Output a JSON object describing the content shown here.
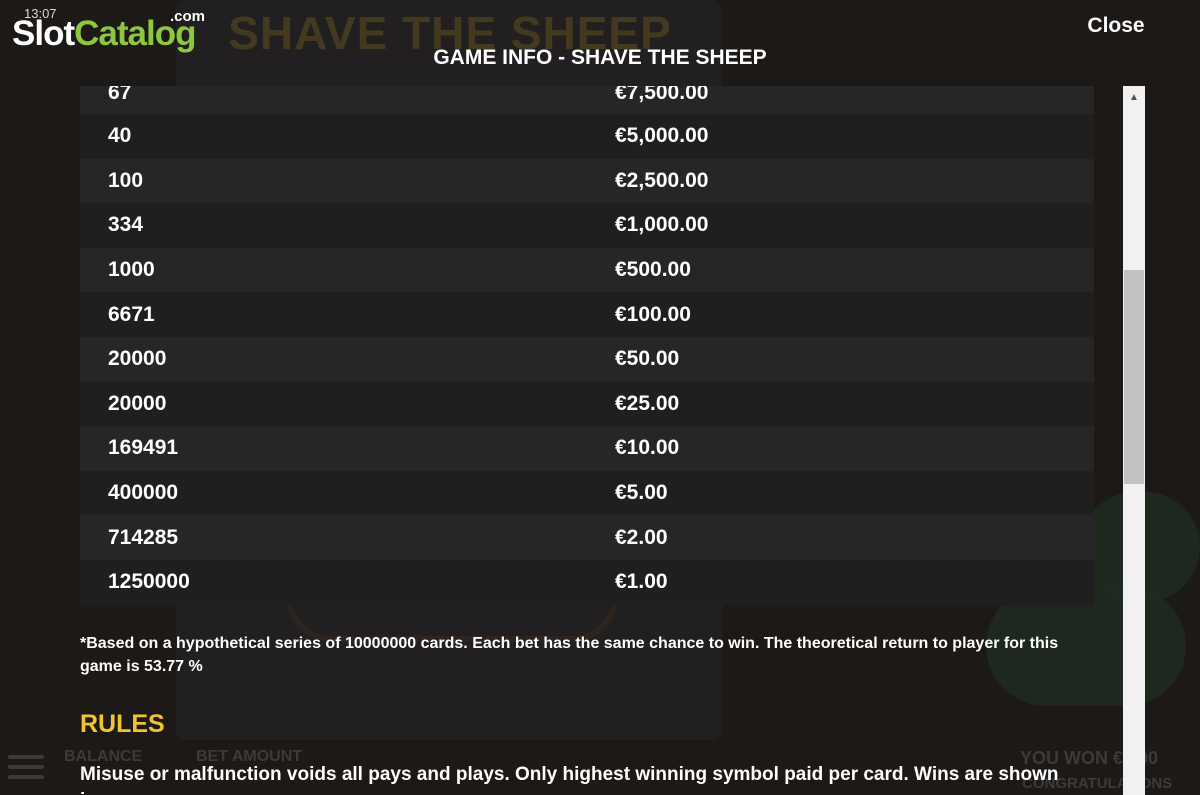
{
  "status": {
    "time": "13:07"
  },
  "logo": {
    "part1": "Slot",
    "part2": "Catalog",
    "suffix": ".com"
  },
  "header": {
    "close_label": "Close",
    "title": "GAME INFO - SHAVE THE SHEEP"
  },
  "pay_table": {
    "rows": [
      {
        "count": "67",
        "prize": "€7,500.00"
      },
      {
        "count": "40",
        "prize": "€5,000.00"
      },
      {
        "count": "100",
        "prize": "€2,500.00"
      },
      {
        "count": "334",
        "prize": "€1,000.00"
      },
      {
        "count": "1000",
        "prize": "€500.00"
      },
      {
        "count": "6671",
        "prize": "€100.00"
      },
      {
        "count": "20000",
        "prize": "€50.00"
      },
      {
        "count": "20000",
        "prize": "€25.00"
      },
      {
        "count": "169491",
        "prize": "€10.00"
      },
      {
        "count": "400000",
        "prize": "€5.00"
      },
      {
        "count": "714285",
        "prize": "€2.00"
      },
      {
        "count": "1250000",
        "prize": "€1.00"
      }
    ]
  },
  "note": "*Based on a hypothetical series of 10000000 cards. Each bet has the same chance to win. The theoretical return to player for this game is 53.77 %",
  "rules": {
    "heading": "RULES",
    "text": "Misuse or malfunction voids all pays and plays. Only highest winning symbol paid per card. Wins are shown in"
  },
  "background": {
    "game_title": "SHAVE THE SHEEP",
    "balance_label": "BALANCE",
    "bet_label": "BET AMOUNT",
    "won_label": "YOU WON €0.00",
    "congrats": "CONGRATULATIONS"
  },
  "colors": {
    "accent_rules": "#f2c230",
    "logo_green": "#8dc63f",
    "row_odd": "#262626",
    "row_even": "#1f1f1f"
  },
  "icons": {
    "scroll_up": "triangle-up-icon",
    "menu": "hamburger-menu-icon"
  }
}
